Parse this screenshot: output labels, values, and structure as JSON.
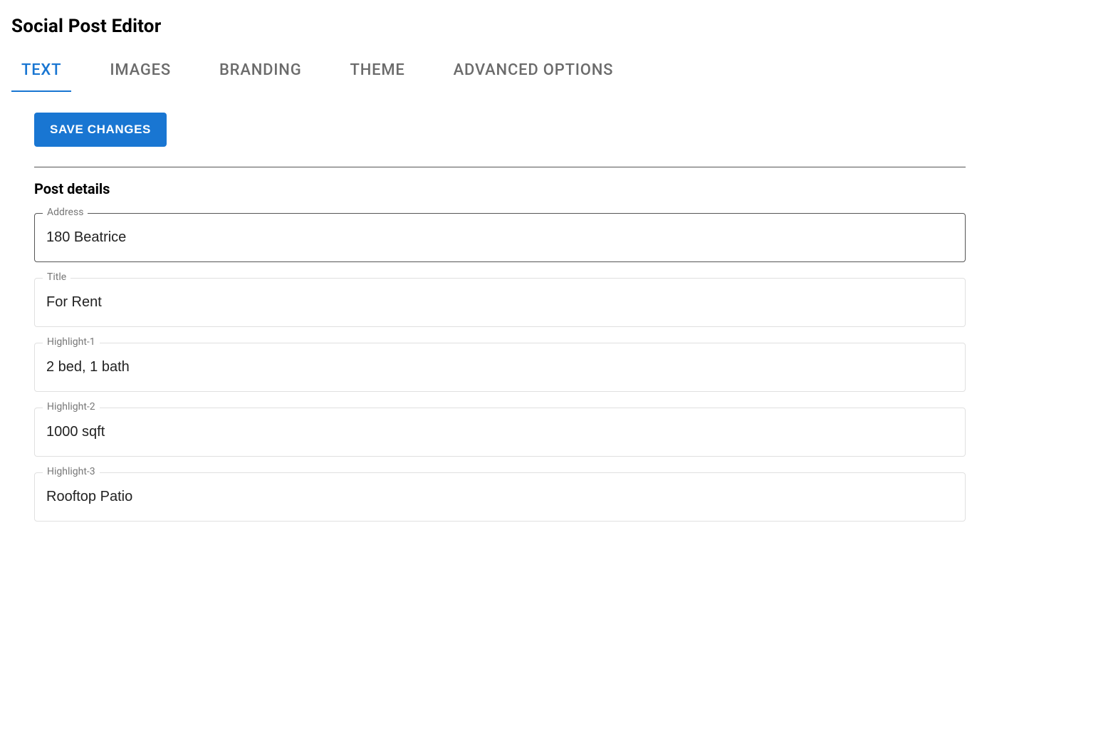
{
  "page": {
    "title": "Social Post Editor"
  },
  "tabs": [
    {
      "label": "TEXT",
      "active": true
    },
    {
      "label": "IMAGES",
      "active": false
    },
    {
      "label": "BRANDING",
      "active": false
    },
    {
      "label": "THEME",
      "active": false
    },
    {
      "label": "ADVANCED OPTIONS",
      "active": false
    }
  ],
  "actions": {
    "save_label": "SAVE CHANGES"
  },
  "section": {
    "title": "Post details"
  },
  "fields": {
    "address": {
      "label": "Address",
      "value": "180 Beatrice"
    },
    "title": {
      "label": "Title",
      "value": "For Rent"
    },
    "highlight1": {
      "label": "Highlight-1",
      "value": "2 bed, 1 bath"
    },
    "highlight2": {
      "label": "Highlight-2",
      "value": "1000 sqft"
    },
    "highlight3": {
      "label": "Highlight-3",
      "value": "Rooftop Patio"
    }
  }
}
